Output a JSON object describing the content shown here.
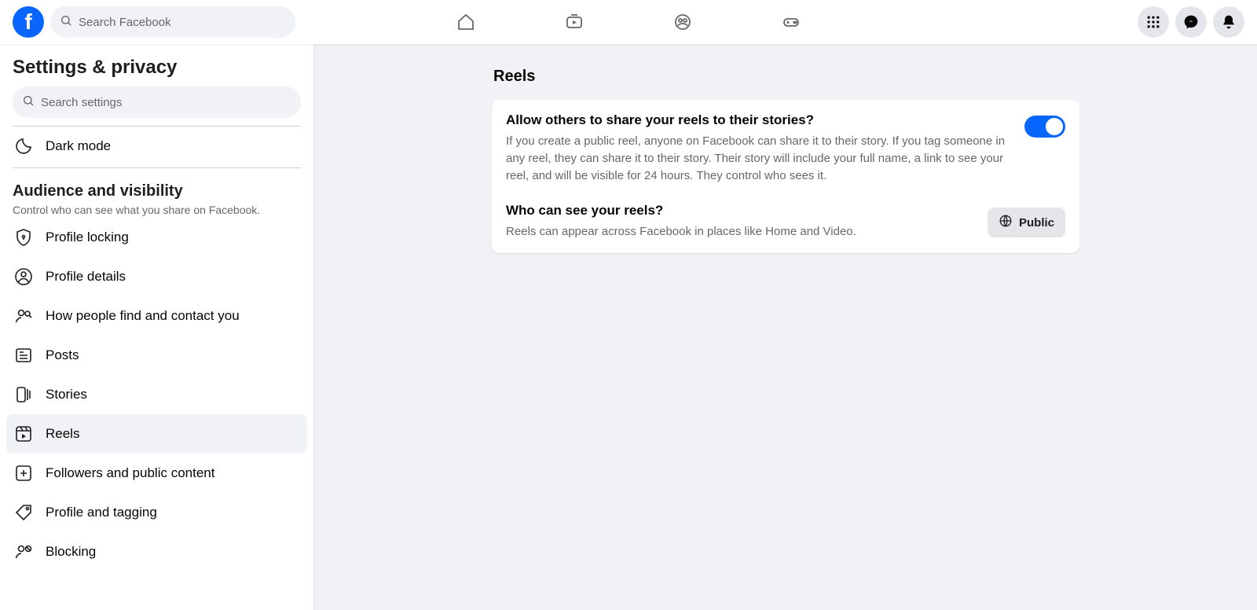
{
  "topbar": {
    "search_placeholder": "Search Facebook"
  },
  "sidebar": {
    "title": "Settings & privacy",
    "search_placeholder": "Search settings",
    "dark_mode_label": "Dark mode",
    "section": {
      "heading": "Audience and visibility",
      "subtext": "Control who can see what you share on Facebook."
    },
    "items": [
      {
        "label": "Profile locking"
      },
      {
        "label": "Profile details"
      },
      {
        "label": "How people find and contact you"
      },
      {
        "label": "Posts"
      },
      {
        "label": "Stories"
      },
      {
        "label": "Reels"
      },
      {
        "label": "Followers and public content"
      },
      {
        "label": "Profile and tagging"
      },
      {
        "label": "Blocking"
      }
    ]
  },
  "main": {
    "title": "Reels",
    "share": {
      "title": "Allow others to share your reels to their stories?",
      "description": "If you create a public reel, anyone on Facebook can share it to their story. If you tag someone in any reel, they can share it to their story. Their story will include your full name, a link to see your reel, and will be visible for 24 hours. They control who sees it.",
      "toggle_on": true
    },
    "audience": {
      "title": "Who can see your reels?",
      "description": "Reels can appear across Facebook in places like Home and Video.",
      "value_label": "Public"
    }
  }
}
